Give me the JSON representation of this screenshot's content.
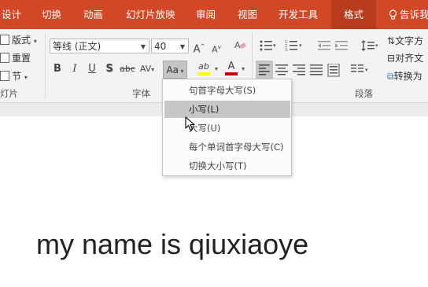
{
  "tabs": [
    {
      "label": "设计"
    },
    {
      "label": "切换"
    },
    {
      "label": "动画"
    },
    {
      "label": "幻灯片放映"
    },
    {
      "label": "审阅"
    },
    {
      "label": "视图"
    },
    {
      "label": "开发工具"
    },
    {
      "label": "格式",
      "active": true
    }
  ],
  "tell_me": "告诉我",
  "colors": {
    "ribbon_accent": "#d24726",
    "active_tab": "#b83b1d",
    "menu_hover": "#c7c7c7"
  },
  "slides_group": {
    "layout_label": "版式",
    "reset_label": "重置",
    "section_label": "节",
    "group_label": "灯片"
  },
  "font_group": {
    "font_name": "等线 (正文)",
    "font_size": "40",
    "grow_label": "A",
    "shrink_label": "A",
    "bold": "B",
    "italic": "I",
    "underline": "U",
    "shadow": "S",
    "strike": "abc",
    "spacing": "AV",
    "change_case": "Aa",
    "highlight": "ab",
    "font_color": "A",
    "group_label": "字体"
  },
  "paragraph_group": {
    "group_label": "段落",
    "text_direction": "文字方",
    "align_text": "对齐文",
    "convert": "转换为"
  },
  "change_case_menu": {
    "items": [
      {
        "label": "句首字母大写(S)",
        "hover": false
      },
      {
        "label": "小写(L)",
        "hover": true
      },
      {
        "label": "大写(U)",
        "hover": false
      },
      {
        "label": "每个单词首字母大写(C)",
        "hover": false
      },
      {
        "label": "切换大小写(T)",
        "hover": false
      }
    ]
  },
  "slide": {
    "text": "my name is qiuxiaoye"
  }
}
